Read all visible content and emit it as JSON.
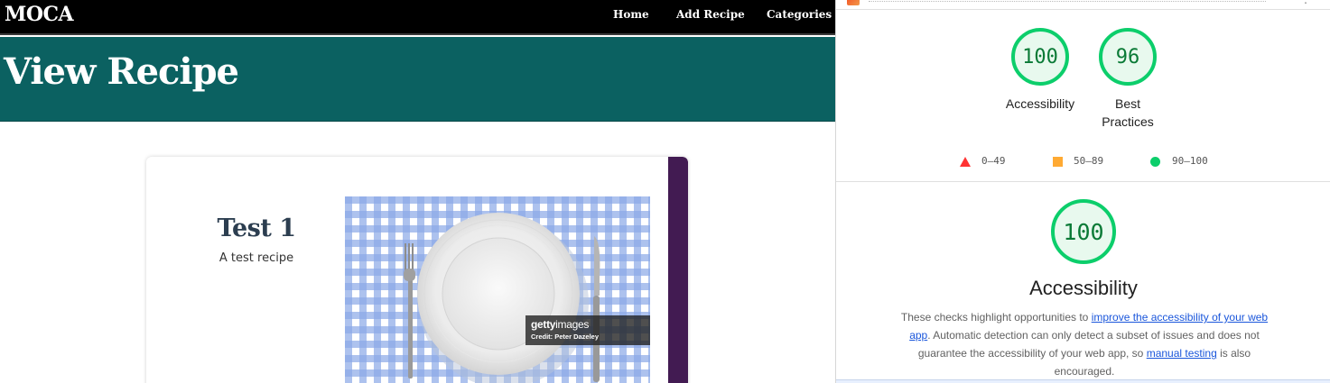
{
  "app": {
    "brand": "MOCA",
    "nav": [
      {
        "label": "Home"
      },
      {
        "label": "Add Recipe"
      },
      {
        "label": "Categories"
      }
    ],
    "page_title": "View Recipe",
    "recipe": {
      "title": "Test 1",
      "description": "A test recipe",
      "image_watermark": {
        "logo_prefix": "getty",
        "logo_suffix": "images",
        "credit": "Credit: Peter Dazeley"
      }
    },
    "colors": {
      "navbar": "#000000",
      "hero": "#0b6161",
      "card_accent": "#421b52"
    }
  },
  "devtools": {
    "scores": [
      {
        "label": "Accessibility",
        "value": 100
      },
      {
        "label": "Best Practices",
        "value": 96
      }
    ],
    "legend": [
      {
        "shape": "triangle",
        "range": "0–49",
        "color": "#ff3333"
      },
      {
        "shape": "square",
        "range": "50–89",
        "color": "#ffaa33"
      },
      {
        "shape": "circle",
        "range": "90–100",
        "color": "#0cce6b"
      }
    ],
    "category": {
      "score": 100,
      "title": "Accessibility",
      "desc_part1": "These checks highlight opportunities to ",
      "link1": "improve the accessibility of your web app",
      "desc_part2": ". Automatic detection can only detect a subset of issues and does not guarantee the accessibility of your web app, so ",
      "link2": "manual testing",
      "desc_part3": " is also encouraged."
    },
    "colors": {
      "pass": "#0cce6b",
      "pass_text": "#0a7a36",
      "link": "#1a56db"
    }
  }
}
